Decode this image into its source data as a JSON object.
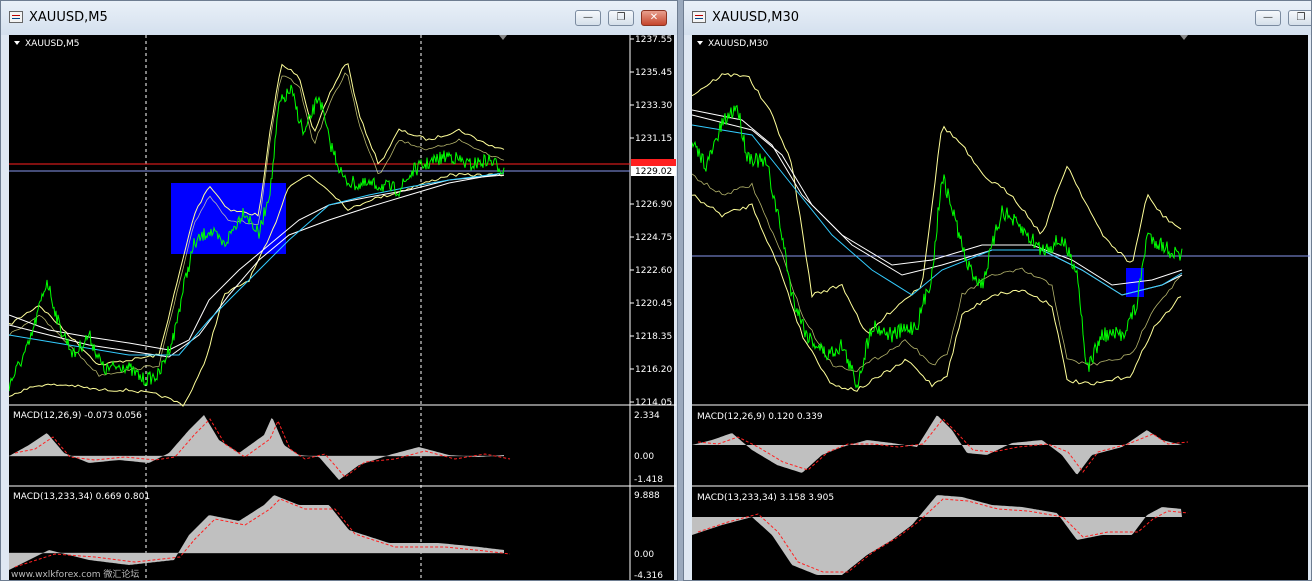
{
  "windows": [
    {
      "id": "m5",
      "title": "XAUUSD,M5",
      "symbol_label": "XAUUSD,M5",
      "price_axis": [
        "1237.55",
        "1235.45",
        "1233.30",
        "1231.15",
        "1229.02",
        "1226.90",
        "1224.75",
        "1222.60",
        "1220.45",
        "1218.35",
        "1216.20",
        "1214.05"
      ],
      "current_price": "1229.02",
      "macd1": {
        "label": "MACD(12,26,9) -0.073 0.056",
        "axis": [
          "2.334",
          "0.00",
          "-1.418"
        ]
      },
      "macd2": {
        "label": "MACD(13,233,34) 0.669 0.801",
        "axis": [
          "9.888",
          "0.00",
          "-4.316"
        ]
      },
      "watermark": "www.wxlkforex.com 微汇论坛"
    },
    {
      "id": "m30",
      "title": "XAUUSD,M30",
      "symbol_label": "XAUUSD,M30",
      "macd1": {
        "label": "MACD(12,26,9) 0.120 0.339"
      },
      "macd2": {
        "label": "MACD(13,233,34) 3.158 3.905"
      }
    }
  ],
  "buttons": {
    "minimize": "—",
    "maximize": "❐",
    "close": "✕"
  },
  "colors": {
    "price": "#00ff00",
    "bands": "#ffff99",
    "ma_cyan": "#33ccff",
    "ma_white": "#ffffff",
    "macd_hist": "#c0c0c0",
    "macd_signal": "#ff2222",
    "highlight": "#0000ff",
    "red_line": "#ff2020",
    "grid": "#ffffff",
    "background": "#000000"
  }
}
